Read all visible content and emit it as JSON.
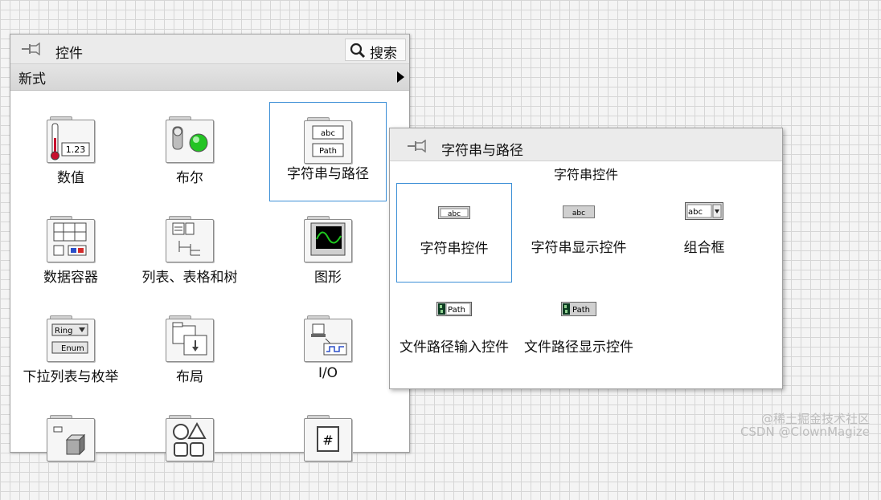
{
  "palette": {
    "title": "控件",
    "search_label": "搜索",
    "category": "新式",
    "items": [
      {
        "label": "数值",
        "icon": "numeric-icon"
      },
      {
        "label": "布尔",
        "icon": "boolean-icon"
      },
      {
        "label": "字符串与路径",
        "icon": "string-path-icon"
      },
      {
        "label": "数据容器",
        "icon": "data-container-icon"
      },
      {
        "label": "列表、表格和树",
        "icon": "list-table-tree-icon"
      },
      {
        "label": "图形",
        "icon": "graph-icon"
      },
      {
        "label": "下拉列表与枚举",
        "icon": "ring-enum-icon"
      },
      {
        "label": "布局",
        "icon": "layout-icon"
      },
      {
        "label": "I/O",
        "icon": "io-icon"
      }
    ],
    "icon_text": {
      "numeric_value": "1.23",
      "string_abc": "abc",
      "string_path": "Path",
      "ring": "Ring",
      "enum": "Enum",
      "hash": "#"
    }
  },
  "popup": {
    "title": "字符串与路径",
    "subtitle": "字符串控件",
    "items": [
      {
        "label": "字符串控件",
        "icon": "string-control-icon",
        "icon_text": "abc"
      },
      {
        "label": "字符串显示控件",
        "icon": "string-indicator-icon",
        "icon_text": "abc"
      },
      {
        "label": "组合框",
        "icon": "combo-box-icon",
        "icon_text": "abc"
      },
      {
        "label": "文件路径输入控件",
        "icon": "file-path-control-icon",
        "icon_text": "Path"
      },
      {
        "label": "文件路径显示控件",
        "icon": "file-path-indicator-icon",
        "icon_text": "Path"
      }
    ]
  },
  "watermark": {
    "line1": "@稀土掘金技术社区",
    "line2": "CSDN @ClownMagize"
  },
  "colors": {
    "selection": "#3c8fd6",
    "canvas_grid": "#d6d6d6"
  }
}
